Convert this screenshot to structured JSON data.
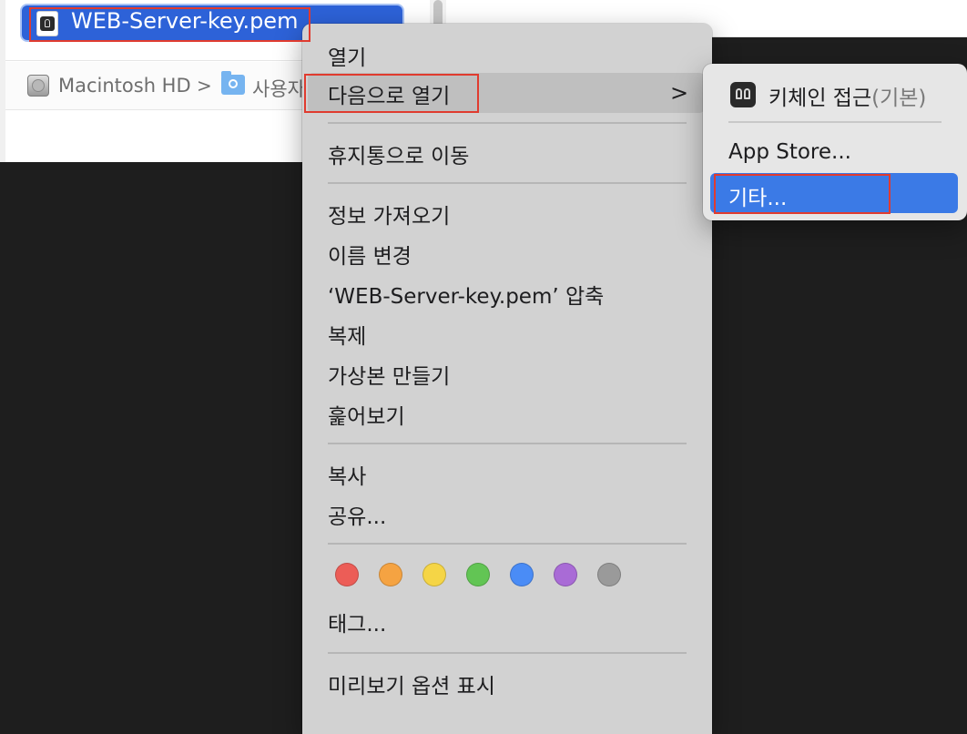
{
  "finder": {
    "selected_file": "WEB-Server-key.pem",
    "path": {
      "disk": "Macintosh HD",
      "separator": ">",
      "folder": "사용자"
    }
  },
  "context_menu": {
    "items": {
      "open": "열기",
      "open_with": "다음으로 열기",
      "move_to_trash": "휴지통으로 이동",
      "get_info": "정보 가져오기",
      "rename": "이름 변경",
      "compress": "‘WEB-Server-key.pem’ 압축",
      "duplicate": "복제",
      "make_alias": "가상본 만들기",
      "quick_look": "훑어보기",
      "copy": "복사",
      "share": "공유...",
      "tags": "태그...",
      "show_view_options": "미리보기 옵션 표시"
    },
    "submenu_arrow": ">",
    "tag_colors": [
      "#ec5d57",
      "#f5a342",
      "#f5d546",
      "#62c554",
      "#4a8cf6",
      "#a96bd6",
      "#9a9a9a"
    ]
  },
  "submenu": {
    "default_app": "키체인 접근",
    "default_suffix": "(기본)",
    "app_store": "App Store...",
    "other": "기타..."
  },
  "colors": {
    "selection": "#2d62d8",
    "submenu_highlight": "#3b7ae6",
    "annotation_box": "#e03b2f"
  }
}
